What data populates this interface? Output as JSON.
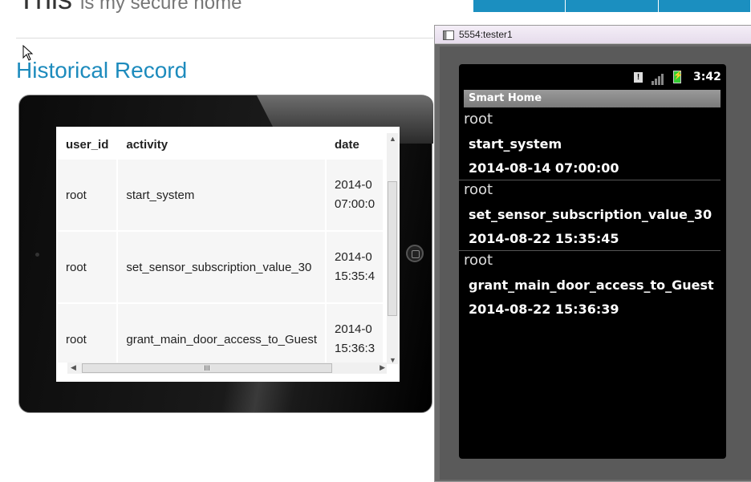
{
  "header": {
    "title_big": "This",
    "title_sub": "is my secure home"
  },
  "page": {
    "heading": "Historical Record"
  },
  "table": {
    "columns": [
      "user_id",
      "activity",
      "date"
    ],
    "rows": [
      {
        "user_id": "root",
        "activity": "start_system",
        "date_line1": "2014-0",
        "date_line2": "07:00:0"
      },
      {
        "user_id": "root",
        "activity": "set_sensor_subscription_value_30",
        "date_line1": "2014-0",
        "date_line2": "15:35:4"
      },
      {
        "user_id": "root",
        "activity": "grant_main_door_access_to_Guest",
        "date_line1": "2014-0",
        "date_line2": "15:36:3"
      }
    ],
    "scroll_grip": "III"
  },
  "emulator": {
    "window_title": "5554:tester1",
    "status_time": "3:42",
    "alert_glyph": "!",
    "app_title": "Smart Home",
    "entries": [
      {
        "user": "root",
        "activity": "start_system",
        "date": "2014-08-14 07:00:00"
      },
      {
        "user": "root",
        "activity": "set_sensor_subscription_value_30",
        "date": "2014-08-22 15:35:45"
      },
      {
        "user": "root",
        "activity": "grant_main_door_access_to_Guest",
        "date": "2014-08-22 15:36:39"
      }
    ]
  },
  "colors": {
    "accent": "#1d8bbd",
    "nav": "#1b8fc0",
    "battery": "#33cc33"
  },
  "icons": [
    "cursor-icon",
    "window-icon",
    "alert-icon",
    "signal-icon",
    "battery-icon",
    "home-button-icon"
  ]
}
